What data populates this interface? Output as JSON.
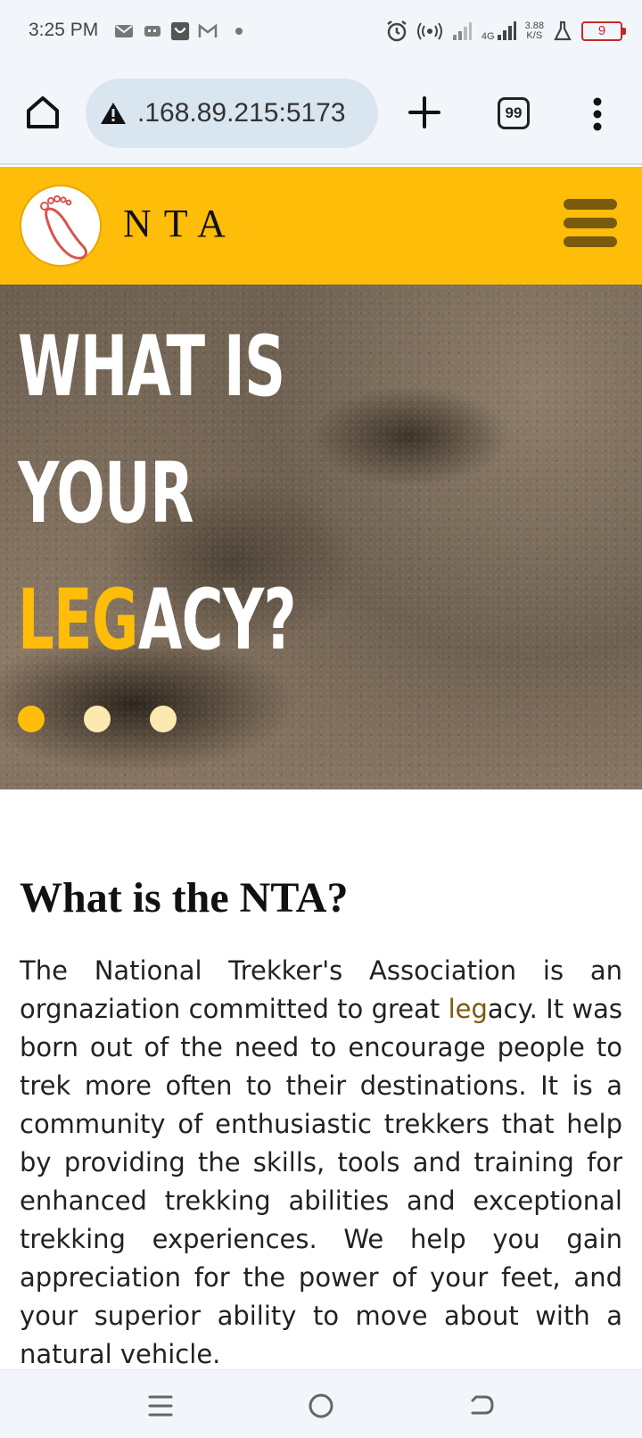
{
  "status_bar": {
    "time": "3:25 PM",
    "network_speed_value": "3.88",
    "network_speed_unit": "K/S",
    "network_type": "4G",
    "battery_level": "9",
    "icons": [
      "gmail-icon",
      "message-icon",
      "shopping-icon",
      "gmail-icon",
      "dot-icon",
      "alarm-icon",
      "hotspot-icon",
      "signal-icon",
      "signal-icon",
      "flask-icon",
      "battery-icon"
    ]
  },
  "browser": {
    "url": ".168.89.215:5173",
    "tab_count": "99",
    "icons": [
      "home-icon",
      "warning-icon",
      "plus-icon",
      "tabs-icon",
      "more-vert-icon"
    ]
  },
  "header": {
    "brand": "NTA",
    "logo_icon": "footprint-icon",
    "menu_icon": "hamburger-icon",
    "accent_color": "#fdbd08"
  },
  "hero": {
    "line1": "WHAT IS YOUR",
    "line2_highlight": "LEG",
    "line2_rest": "ACY?",
    "slides": 3,
    "active_slide": 1
  },
  "about": {
    "title": "What is the NTA?",
    "body_before": "The National Trekker's Association is an orgnaziation committed to great ",
    "body_highlight": "leg",
    "body_after": "acy. It was born out of the need to encourage people to trek more often to their destinations. It is a community of enthusiastic trekkers that help by providing the skills, tools and training for enhanced trekking abilities and exceptional trekking experiences. We help you gain appreciation for the power of your feet, and your superior ability to move about with a natural vehicle."
  },
  "nav_bar": {
    "icons": [
      "recents-icon",
      "home-circle-icon",
      "back-icon"
    ]
  }
}
